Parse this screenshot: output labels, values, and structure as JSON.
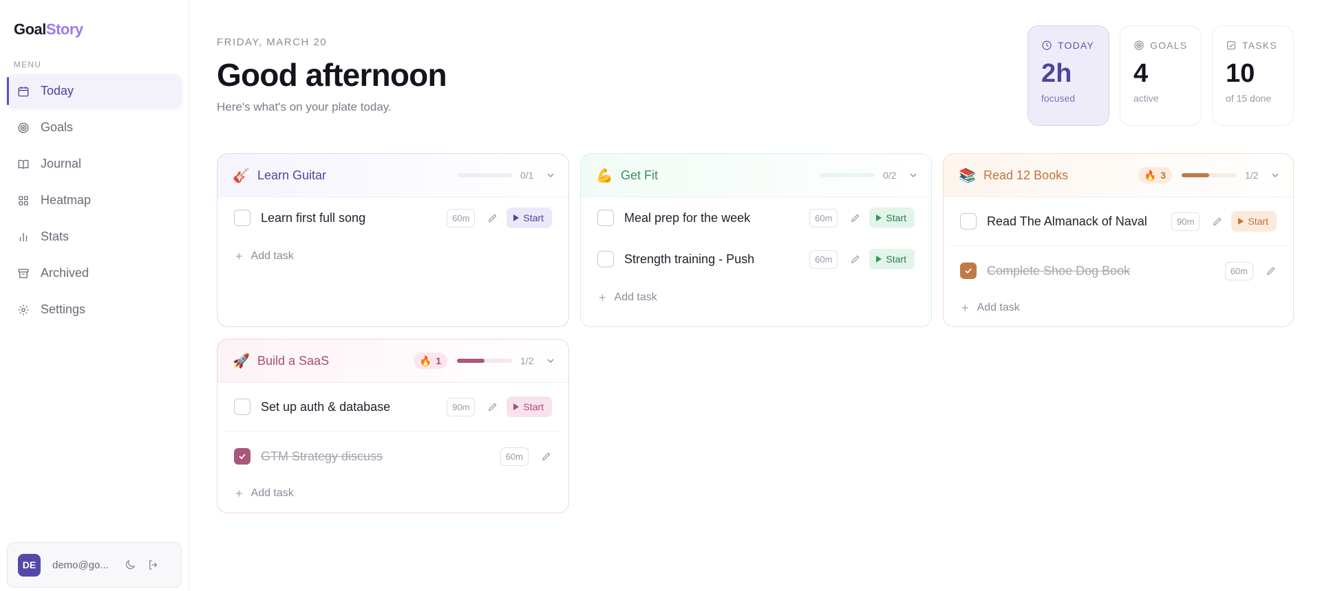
{
  "app": {
    "logo_part1": "Goal",
    "logo_part2": "Story"
  },
  "sidebar": {
    "menu_label": "MENU",
    "items": [
      {
        "label": "Today",
        "icon": "calendar-icon",
        "active": true
      },
      {
        "label": "Goals",
        "icon": "target-icon"
      },
      {
        "label": "Journal",
        "icon": "book-icon"
      },
      {
        "label": "Heatmap",
        "icon": "grid-icon"
      },
      {
        "label": "Stats",
        "icon": "bar-chart-icon"
      },
      {
        "label": "Archived",
        "icon": "archive-icon"
      },
      {
        "label": "Settings",
        "icon": "gear-icon"
      }
    ],
    "user": {
      "initials": "DE",
      "email": "demo@go..."
    }
  },
  "header": {
    "date": "FRIDAY, MARCH 20",
    "greeting": "Good afternoon",
    "subtitle": "Here's what's on your plate today."
  },
  "stats": {
    "today": {
      "label": "TODAY",
      "value": "2h",
      "sub": "focused",
      "icon": "clock-icon"
    },
    "goals": {
      "label": "GOALS",
      "value": "4",
      "sub": "active",
      "icon": "target-icon"
    },
    "tasks": {
      "label": "TASKS",
      "value": "10",
      "sub": "of 15 done",
      "icon": "check-square-icon"
    }
  },
  "common": {
    "add_task": "Add task",
    "start": "Start"
  },
  "goals": {
    "guitar": {
      "emoji": "🎸",
      "title": "Learn Guitar",
      "progress": "0/1",
      "progress_fraction": 0,
      "tasks": [
        {
          "name": "Learn first full song",
          "duration": "60m"
        }
      ]
    },
    "fit": {
      "emoji": "💪",
      "title": "Get Fit",
      "progress": "0/2",
      "progress_fraction": 0,
      "tasks": [
        {
          "name": "Meal prep for the week",
          "duration": "60m"
        },
        {
          "name": "Strength training - Push",
          "duration": "60m"
        }
      ]
    },
    "books": {
      "emoji": "📚",
      "title": "Read 12 Books",
      "streak": "3",
      "progress": "1/2",
      "progress_fraction": 0.5,
      "tasks": [
        {
          "name": "Read The Almanack of Naval",
          "duration": "90m"
        },
        {
          "name": "Complete Shoe Dog Book",
          "duration": "60m",
          "done": true
        }
      ]
    },
    "saas": {
      "emoji": "🚀",
      "title": "Build a SaaS",
      "streak": "1",
      "progress": "1/2",
      "progress_fraction": 0.5,
      "tasks": [
        {
          "name": "Set up auth & database",
          "duration": "90m"
        },
        {
          "name": "GTM Strategy discuss",
          "duration": "60m",
          "done": true
        }
      ]
    }
  },
  "colors": {
    "accent": "#5549a8",
    "logo_accent": "#9b7bea",
    "green": "#3f8a5f",
    "orange": "#c0733e",
    "rose": "#a64f72"
  }
}
